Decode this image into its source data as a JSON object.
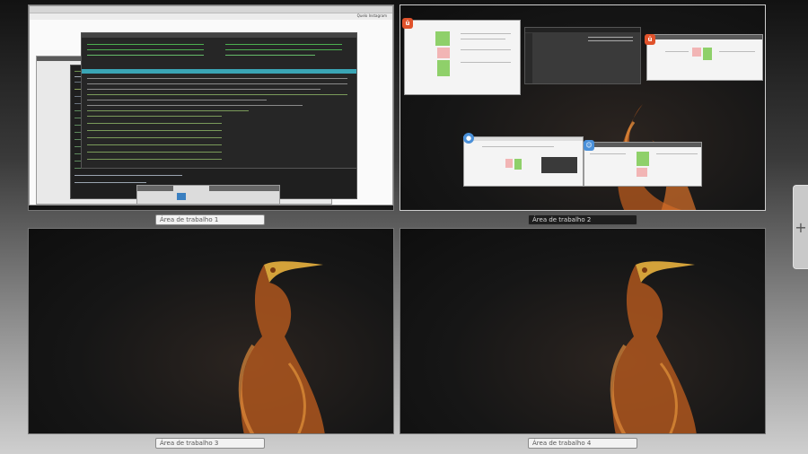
{
  "workspaces": [
    {
      "label": "Área de trabalho 1",
      "active": false
    },
    {
      "label": "Área de trabalho 2",
      "active": true
    },
    {
      "label": "Área de trabalho 3",
      "active": false
    },
    {
      "label": "Área de trabalho 4",
      "active": false
    }
  ],
  "add_workspace": {
    "label": "+"
  },
  "browser": {
    "user_label": "Quelo  Instagram"
  },
  "colors": {
    "accent_green": "#8fd06a",
    "accent_orange": "#e0522b",
    "chrome_blue": "#4a90d9"
  },
  "icons": {
    "add": "plus-icon",
    "app_orange": "app-icon",
    "chrome": "chrome-icon",
    "finder": "finder-icon"
  }
}
